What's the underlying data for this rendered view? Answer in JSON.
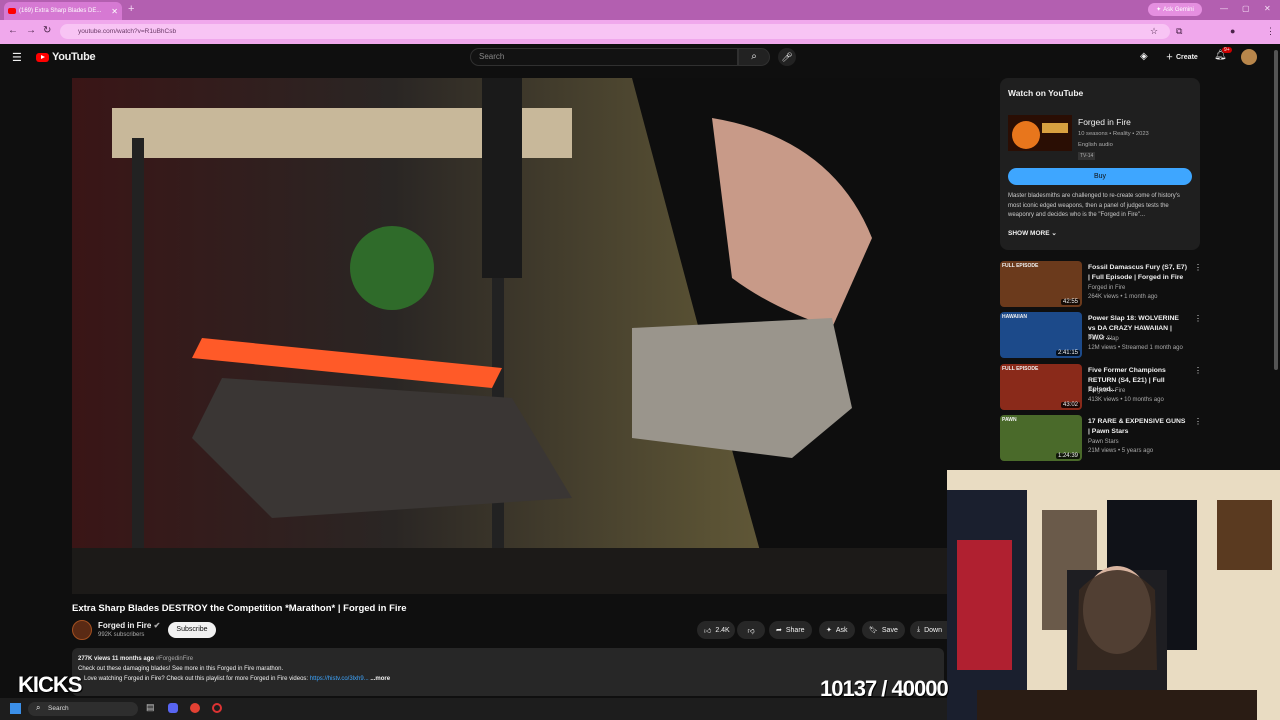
{
  "browser": {
    "tab_title": "(169) Extra Sharp Blades DE...",
    "url": "youtube.com/watch?v=R1uBhCsb",
    "ask_gemini": "Ask Gemini",
    "new_tab": "+",
    "icons": [
      "back-icon",
      "forward-icon",
      "reload-icon",
      "star-icon",
      "extensions-icon",
      "menu-icon"
    ]
  },
  "youtube": {
    "logo_text": "YouTube",
    "search_placeholder": "Search",
    "create_label": "Create",
    "notif_count": "9+"
  },
  "video": {
    "title": "Extra Sharp Blades DESTROY the Competition *Marathon* | Forged in Fire",
    "channel": "Forged in Fire",
    "subscribers": "992K subscribers",
    "subscribe_label": "Subscribe",
    "likes": "2.4K",
    "share_label": "Share",
    "ask_label": "Ask",
    "save_label": "Save",
    "download_label": "Down",
    "stats": "277K views  11 months ago",
    "hashtag": "#ForgedinFire",
    "desc_line1": "Check out these damaging blades! See more in this Forged in Fire marathon.",
    "desc_line2": "Love watching Forged in Fire? Check out this playlist for more Forged in Fire videos:",
    "desc_link": "https://histv.co/3lxh9...",
    "desc_more": "...more"
  },
  "panel": {
    "heading": "Watch on YouTube",
    "show_title": "Forged in Fire",
    "show_meta": "10 seasons • Reality • 2023",
    "show_audio": "English audio",
    "show_rating": "TV-14",
    "buy_label": "Buy",
    "description": "Master bladesmiths are challenged to re-create some of history's most iconic edged weapons, then a panel of judges tests the weaponry and decides who is the \"Forged in Fire\"...",
    "show_more": "SHOW MORE"
  },
  "recommendations": [
    {
      "title": "Fossil Damascus Fury (S7, E7) | Full Episode | Forged in Fire",
      "channel": "Forged in Fire",
      "meta": "264K views • 1 month ago",
      "duration": "42:55",
      "thumb_color": "#6b3a1c",
      "badge": "FULL EPISODE"
    },
    {
      "title": "Power Slap 18: WOLVERINE vs DA CRAZY HAWAIIAN | TWO ...",
      "channel": "Power Slap",
      "meta": "12M views • Streamed 1 month ago",
      "duration": "2:41:15",
      "thumb_color": "#1c4a8a",
      "badge": "HAWAIIAN"
    },
    {
      "title": "Five Former Champions RETURN (S4, E21) | Full Episod...",
      "channel": "Forged in Fire",
      "meta": "413K views • 10 months ago",
      "duration": "43:02",
      "thumb_color": "#8a2a1a",
      "badge": "FULL EPISODE"
    },
    {
      "title": "17 RARE & EXPENSIVE GUNS | Pawn Stars",
      "channel": "Pawn Stars",
      "meta": "21M views • 5 years ago",
      "duration": "1:24:39",
      "thumb_color": "#4a6a2a",
      "badge": "PAWN"
    }
  ],
  "overlay": {
    "kicks_label": "KICKS",
    "counter": "10137 / 40000"
  },
  "taskbar": {
    "search_label": "Search"
  },
  "colors": {
    "accent_blue": "#3ea6ff",
    "yt_red": "#ff0000",
    "browser_pink": "#f0a8ec"
  }
}
